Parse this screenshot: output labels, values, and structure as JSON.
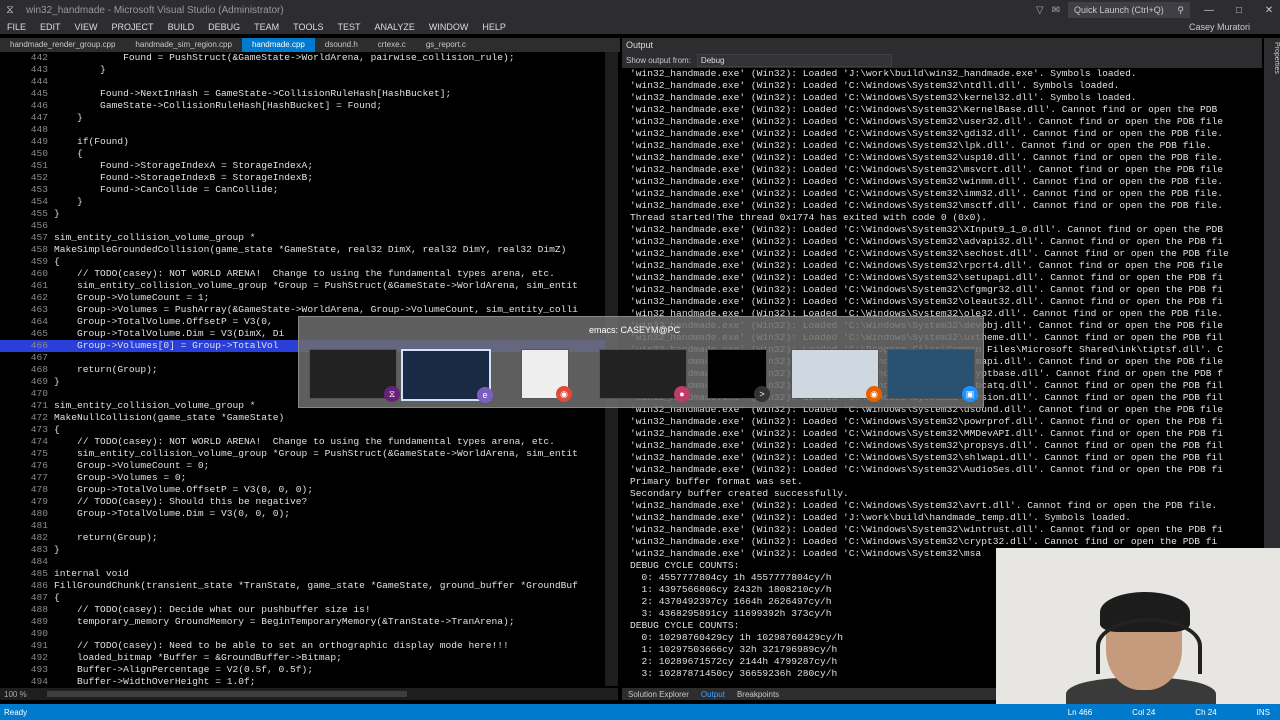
{
  "window": {
    "title": "win32_handmade - Microsoft Visual Studio (Administrator)",
    "quick_launch": "Quick Launch (Ctrl+Q)",
    "user": "Casey Muratori"
  },
  "menu": [
    "FILE",
    "EDIT",
    "VIEW",
    "PROJECT",
    "BUILD",
    "DEBUG",
    "TEAM",
    "TOOLS",
    "TEST",
    "ANALYZE",
    "WINDOW",
    "HELP"
  ],
  "tabs": [
    {
      "label": "handmade_render_group.cpp",
      "active": false
    },
    {
      "label": "handmade_sim_region.cpp",
      "active": false
    },
    {
      "label": "handmade.cpp",
      "active": true
    },
    {
      "label": "dsound.h",
      "active": false
    },
    {
      "label": "crtexe.c",
      "active": false
    },
    {
      "label": "gs_report.c",
      "active": false
    }
  ],
  "editor": {
    "zoom": "100 %",
    "lines": [
      {
        "n": "442",
        "t": "            Found = PushStruct(&GameState->WorldArena, pairwise_collision_rule);"
      },
      {
        "n": "443",
        "t": "        }"
      },
      {
        "n": "444",
        "t": ""
      },
      {
        "n": "445",
        "t": "        Found->NextInHash = GameState->CollisionRuleHash[HashBucket];"
      },
      {
        "n": "446",
        "t": "        GameState->CollisionRuleHash[HashBucket] = Found;"
      },
      {
        "n": "447",
        "t": "    }"
      },
      {
        "n": "448",
        "t": ""
      },
      {
        "n": "449",
        "t": "    if(Found)"
      },
      {
        "n": "450",
        "t": "    {"
      },
      {
        "n": "451",
        "t": "        Found->StorageIndexA = StorageIndexA;"
      },
      {
        "n": "452",
        "t": "        Found->StorageIndexB = StorageIndexB;"
      },
      {
        "n": "453",
        "t": "        Found->CanCollide = CanCollide;"
      },
      {
        "n": "454",
        "t": "    }"
      },
      {
        "n": "455",
        "t": "}"
      },
      {
        "n": "456",
        "t": ""
      },
      {
        "n": "457",
        "t": "sim_entity_collision_volume_group *"
      },
      {
        "n": "458",
        "t": "MakeSimpleGroundedCollision(game_state *GameState, real32 DimX, real32 DimY, real32 DimZ)"
      },
      {
        "n": "459",
        "t": "{"
      },
      {
        "n": "460",
        "t": "    // TODO(casey): NOT WORLD ARENA!  Change to using the fundamental types arena, etc."
      },
      {
        "n": "461",
        "t": "    sim_entity_collision_volume_group *Group = PushStruct(&GameState->WorldArena, sim_entit"
      },
      {
        "n": "462",
        "t": "    Group->VolumeCount = 1;"
      },
      {
        "n": "463",
        "t": "    Group->Volumes = PushArray(&GameState->WorldArena, Group->VolumeCount, sim_entity_colli"
      },
      {
        "n": "464",
        "t": "    Group->TotalVolume.OffsetP = V3(0,"
      },
      {
        "n": "465",
        "t": "    Group->TotalVolume.Dim = V3(DimX, Di"
      },
      {
        "n": "466",
        "t": "    Group->Volumes[0] = Group->TotalVol",
        "hl": true
      },
      {
        "n": "467",
        "t": ""
      },
      {
        "n": "468",
        "t": "    return(Group);"
      },
      {
        "n": "469",
        "t": "}"
      },
      {
        "n": "470",
        "t": ""
      },
      {
        "n": "471",
        "t": "sim_entity_collision_volume_group *"
      },
      {
        "n": "472",
        "t": "MakeNullCollision(game_state *GameState)"
      },
      {
        "n": "473",
        "t": "{"
      },
      {
        "n": "474",
        "t": "    // TODO(casey): NOT WORLD ARENA!  Change to using the fundamental types arena, etc."
      },
      {
        "n": "475",
        "t": "    sim_entity_collision_volume_group *Group = PushStruct(&GameState->WorldArena, sim_entit"
      },
      {
        "n": "476",
        "t": "    Group->VolumeCount = 0;"
      },
      {
        "n": "477",
        "t": "    Group->Volumes = 0;"
      },
      {
        "n": "478",
        "t": "    Group->TotalVolume.OffsetP = V3(0, 0, 0);"
      },
      {
        "n": "479",
        "t": "    // TODO(casey): Should this be negative?"
      },
      {
        "n": "480",
        "t": "    Group->TotalVolume.Dim = V3(0, 0, 0);"
      },
      {
        "n": "481",
        "t": ""
      },
      {
        "n": "482",
        "t": "    return(Group);"
      },
      {
        "n": "483",
        "t": "}"
      },
      {
        "n": "484",
        "t": ""
      },
      {
        "n": "485",
        "t": "internal void"
      },
      {
        "n": "486",
        "t": "FillGroundChunk(transient_state *TranState, game_state *GameState, ground_buffer *GroundBuf"
      },
      {
        "n": "487",
        "t": "{"
      },
      {
        "n": "488",
        "t": "    // TODO(casey): Decide what our pushbuffer size is!"
      },
      {
        "n": "489",
        "t": "    temporary_memory GroundMemory = BeginTemporaryMemory(&TranState->TranArena);"
      },
      {
        "n": "490",
        "t": ""
      },
      {
        "n": "491",
        "t": "    // TODO(casey): Need to be able to set an orthographic display mode here!!!"
      },
      {
        "n": "492",
        "t": "    loaded_bitmap *Buffer = &GroundBuffer->Bitmap;"
      },
      {
        "n": "493",
        "t": "    Buffer->AlignPercentage = V2(0.5f, 0.5f);"
      },
      {
        "n": "494",
        "t": "    Buffer->WidthOverHeight = 1.0f;"
      }
    ]
  },
  "output": {
    "title": "Output",
    "show_from_label": "Show output from:",
    "show_from_value": "Debug",
    "lines": [
      "'win32_handmade.exe' (Win32): Loaded 'J:\\work\\build\\win32_handmade.exe'. Symbols loaded.",
      "'win32_handmade.exe' (Win32): Loaded 'C:\\Windows\\System32\\ntdll.dll'. Symbols loaded.",
      "'win32_handmade.exe' (Win32): Loaded 'C:\\Windows\\System32\\kernel32.dll'. Symbols loaded.",
      "'win32_handmade.exe' (Win32): Loaded 'C:\\Windows\\System32\\KernelBase.dll'. Cannot find or open the PDB",
      "'win32_handmade.exe' (Win32): Loaded 'C:\\Windows\\System32\\user32.dll'. Cannot find or open the PDB file",
      "'win32_handmade.exe' (Win32): Loaded 'C:\\Windows\\System32\\gdi32.dll'. Cannot find or open the PDB file.",
      "'win32_handmade.exe' (Win32): Loaded 'C:\\Windows\\System32\\lpk.dll'. Cannot find or open the PDB file.",
      "'win32_handmade.exe' (Win32): Loaded 'C:\\Windows\\System32\\usp10.dll'. Cannot find or open the PDB file.",
      "'win32_handmade.exe' (Win32): Loaded 'C:\\Windows\\System32\\msvcrt.dll'. Cannot find or open the PDB file",
      "'win32_handmade.exe' (Win32): Loaded 'C:\\Windows\\System32\\winmm.dll'. Cannot find or open the PDB file.",
      "'win32_handmade.exe' (Win32): Loaded 'C:\\Windows\\System32\\imm32.dll'. Cannot find or open the PDB file.",
      "'win32_handmade.exe' (Win32): Loaded 'C:\\Windows\\System32\\msctf.dll'. Cannot find or open the PDB file.",
      "Thread started!The thread 0x1774 has exited with code 0 (0x0).",
      "'win32_handmade.exe' (Win32): Loaded 'C:\\Windows\\System32\\XInput9_1_0.dll'. Cannot find or open the PDB",
      "'win32_handmade.exe' (Win32): Loaded 'C:\\Windows\\System32\\advapi32.dll'. Cannot find or open the PDB fi",
      "'win32_handmade.exe' (Win32): Loaded 'C:\\Windows\\System32\\sechost.dll'. Cannot find or open the PDB file",
      "'win32_handmade.exe' (Win32): Loaded 'C:\\Windows\\System32\\rpcrt4.dll'. Cannot find or open the PDB file",
      "'win32_handmade.exe' (Win32): Loaded 'C:\\Windows\\System32\\setupapi.dll'. Cannot find or open the PDB fi",
      "'win32_handmade.exe' (Win32): Loaded 'C:\\Windows\\System32\\cfgmgr32.dll'. Cannot find or open the PDB fi",
      "'win32_handmade.exe' (Win32): Loaded 'C:\\Windows\\System32\\oleaut32.dll'. Cannot find or open the PDB fi",
      "'win32_handmade.exe' (Win32): Loaded 'C:\\Windows\\System32\\ole32.dll'. Cannot find or open the PDB file.",
      "'win32_handmade.exe' (Win32): Loaded 'C:\\Windows\\System32\\devobj.dll'. Cannot find or open the PDB file",
      "'win32_handmade.exe' (Win32): Loaded 'C:\\Windows\\System32\\uxtheme.dll'. Cannot find or open the PDB fil",
      "'win32_handmade.exe' (Win32): Loaded 'C:\\Program Files\\Common Files\\Microsoft Shared\\ink\\tiptsf.dll'. C",
      "'win32_handmade.exe' (Win32): Loaded 'C:\\Windows\\System32\\dwmapi.dll'. Cannot find or open the PDB file",
      "'win32_handmade.exe' (Win32): Loaded 'C:\\Windows\\System32\\cryptbase.dll'. Cannot find or open the PDB f",
      "'win32_handmade.exe' (Win32): Loaded 'C:\\Windows\\System32\\clbcatq.dll'. Cannot find or open the PDB fil",
      "'win32_handmade.exe' (Win32): Loaded 'C:\\Windows\\System32\\version.dll'. Cannot find or open the PDB fil",
      "'win32_handmade.exe' (Win32): Loaded 'C:\\Windows\\System32\\dsound.dll'. Cannot find or open the PDB file",
      "'win32_handmade.exe' (Win32): Loaded 'C:\\Windows\\System32\\powrprof.dll'. Cannot find or open the PDB fi",
      "'win32_handmade.exe' (Win32): Loaded 'C:\\Windows\\System32\\MMDevAPI.dll'. Cannot find or open the PDB fi",
      "'win32_handmade.exe' (Win32): Loaded 'C:\\Windows\\System32\\propsys.dll'. Cannot find or open the PDB fil",
      "'win32_handmade.exe' (Win32): Loaded 'C:\\Windows\\System32\\shlwapi.dll'. Cannot find or open the PDB fil",
      "'win32_handmade.exe' (Win32): Loaded 'C:\\Windows\\System32\\AudioSes.dll'. Cannot find or open the PDB fi",
      "Primary buffer format was set.",
      "Secondary buffer created successfully.",
      "'win32_handmade.exe' (Win32): Loaded 'C:\\Windows\\System32\\avrt.dll'. Cannot find or open the PDB file.",
      "'win32_handmade.exe' (Win32): Loaded 'J:\\work\\build\\handmade_temp.dll'. Symbols loaded.",
      "'win32_handmade.exe' (Win32): Loaded 'C:\\Windows\\System32\\wintrust.dll'. Cannot find or open the PDB fi",
      "'win32_handmade.exe' (Win32): Loaded 'C:\\Windows\\System32\\crypt32.dll'. Cannot find or open the PDB fi",
      "'win32_handmade.exe' (Win32): Loaded 'C:\\Windows\\System32\\msa",
      "DEBUG CYCLE COUNTS:",
      "  0: 4557777804cy 1h 4557777804cy/h",
      "  1: 4397566806cy 2432h 1808210cy/h",
      "  2: 4370492397cy 1664h 2626497cy/h",
      "  3: 4368295891cy 11699392h 373cy/h",
      "DEBUG CYCLE COUNTS:",
      "  0: 10298760429cy 1h 10298760429cy/h",
      "  1: 10297503666cy 32h 321796989cy/h",
      "  2: 10289671572cy 2144h 4799287cy/h",
      "  3: 10287871450cy 36659236h 280cy/h"
    ]
  },
  "bottom_tabs": [
    {
      "label": "Solution Explorer",
      "active": false
    },
    {
      "label": "Output",
      "active": true
    },
    {
      "label": "Breakpoints",
      "active": false
    }
  ],
  "status": {
    "ready": "Ready",
    "ln": "Ln 466",
    "col": "Col 24",
    "ch": "Ch 24",
    "ins": "INS"
  },
  "task_switcher": {
    "title": "emacs: CASEYM@PC"
  },
  "right_sidebar": "Properties"
}
